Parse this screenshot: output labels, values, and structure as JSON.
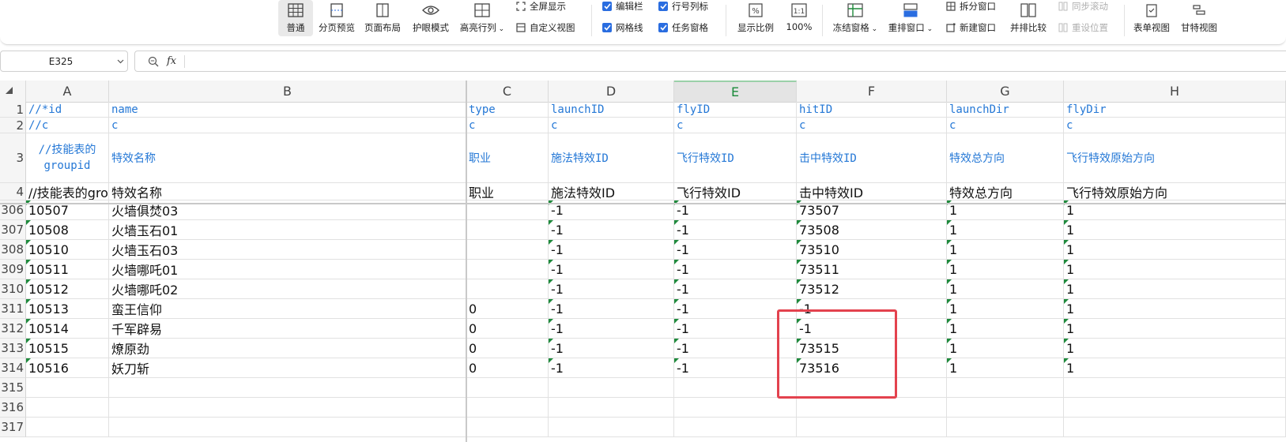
{
  "ribbon": {
    "big_buttons": [
      {
        "label": "普通",
        "icon": "grid-icon"
      },
      {
        "label": "分页预览",
        "icon": "page-break-icon"
      },
      {
        "label": "页面布局",
        "icon": "page-layout-icon"
      },
      {
        "label": "护眼模式",
        "icon": "eye-icon"
      },
      {
        "label": "高亮行列",
        "icon": "crosshair-icon"
      }
    ],
    "fullscreen_label": "全屏显示",
    "custom_view_label": "自定义视图",
    "checkboxes": [
      {
        "label": "编辑栏",
        "checked": true
      },
      {
        "label": "行号列标",
        "checked": true
      },
      {
        "label": "网格线",
        "checked": true
      },
      {
        "label": "任务窗格",
        "checked": true
      }
    ],
    "zoom_label": "显示比例",
    "zoom100_label": "100%",
    "freeze_label": "冻结窗格",
    "arrange_label": "重排窗口",
    "split_label": "拆分窗口",
    "new_window_label": "新建窗口",
    "side_by_side_label": "并排比较",
    "sync_scroll_label": "同步滚动",
    "reset_position_label": "重设位置",
    "form_view_label": "表单视图",
    "gantt_view_label": "甘特视图"
  },
  "formula_bar": {
    "name_box": "E325",
    "fx": "fx",
    "value": ""
  },
  "columns": [
    "A",
    "B",
    "C",
    "D",
    "E",
    "F",
    "G",
    "H"
  ],
  "selected_column": "E",
  "header_rows": [
    {
      "num": "1",
      "cells": [
        "//*id",
        "name",
        "type",
        "launchID",
        "flyID",
        "hitID",
        "launchDir",
        "flyDir"
      ]
    },
    {
      "num": "2",
      "cells": [
        "//c",
        "c",
        "c",
        "c",
        "c",
        "c",
        "c",
        "c"
      ]
    },
    {
      "num": "3",
      "cells": [
        "//技能表的 groupid",
        "特效名称",
        "职业",
        "施法特效ID",
        "飞行特效ID",
        "击中特效ID",
        "特效总方向",
        "飞行特效原始方向"
      ]
    },
    {
      "num": "4",
      "cells": [
        "//技能表的groupid",
        "特效名称",
        "职业",
        "施法特效ID",
        "飞行特效ID",
        "击中特效ID",
        "特效总方向",
        "飞行特效原始方向"
      ]
    }
  ],
  "data_rows": [
    {
      "num": "306",
      "cells": [
        "10507",
        "火墙俱焚03",
        "",
        "-1",
        "-1",
        "73507",
        "1",
        "1"
      ]
    },
    {
      "num": "307",
      "cells": [
        "10508",
        "火墙玉石01",
        "",
        "-1",
        "-1",
        "73508",
        "1",
        "1"
      ]
    },
    {
      "num": "308",
      "cells": [
        "10510",
        "火墙玉石03",
        "",
        "-1",
        "-1",
        "73510",
        "1",
        "1"
      ]
    },
    {
      "num": "309",
      "cells": [
        "10511",
        "火墙哪吒01",
        "",
        "-1",
        "-1",
        "73511",
        "1",
        "1"
      ]
    },
    {
      "num": "310",
      "cells": [
        "10512",
        "火墙哪吒02",
        "",
        "-1",
        "-1",
        "73512",
        "1",
        "1"
      ]
    },
    {
      "num": "311",
      "cells": [
        "10513",
        "蛮王信仰",
        "0",
        "-1",
        "-1",
        "-1",
        "1",
        "1"
      ]
    },
    {
      "num": "312",
      "cells": [
        "10514",
        "千军辟易",
        "0",
        "-1",
        "-1",
        "-1",
        "1",
        "1"
      ]
    },
    {
      "num": "313",
      "cells": [
        "10515",
        "燎原劲",
        "0",
        "-1",
        "-1",
        "73515",
        "1",
        "1"
      ]
    },
    {
      "num": "314",
      "cells": [
        "10516",
        "妖刀斩",
        "0",
        "-1",
        "-1",
        "73516",
        "1",
        "1"
      ]
    },
    {
      "num": "315",
      "cells": [
        "",
        "",
        "",
        "",
        "",
        "",
        "",
        ""
      ]
    },
    {
      "num": "316",
      "cells": [
        "",
        "",
        "",
        "",
        "",
        "",
        "",
        ""
      ]
    },
    {
      "num": "317",
      "cells": [
        "",
        "",
        "",
        "",
        "",
        "",
        "",
        ""
      ]
    }
  ],
  "colors": {
    "header_text_blue": "#2578d6",
    "highlight_red": "#e3424e",
    "checkbox_blue": "#2a6de0",
    "green_flag": "#1e8a3c",
    "selected_col_text": "#1a8a3a"
  }
}
